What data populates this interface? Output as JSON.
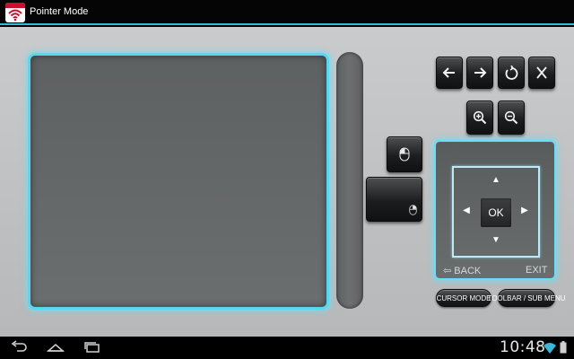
{
  "window": {
    "title": "Pointer Mode",
    "app_icon": "wifi-signal-icon",
    "accent_color": "#3ab7d6"
  },
  "toolbar": {
    "back_icon": "arrow-left-icon",
    "forward_icon": "arrow-right-icon",
    "reload_icon": "rotate-icon",
    "close_icon": "close-x-icon",
    "zoom_in_icon": "zoom-in-icon",
    "zoom_out_icon": "zoom-out-icon"
  },
  "mouse": {
    "left_click_icon": "mouse-left-button-icon",
    "right_click_icon": "mouse-right-button-icon"
  },
  "dpad": {
    "up": "▲",
    "down": "▼",
    "left": "◀",
    "right": "▶",
    "ok_label": "OK",
    "back_label": "⇦ BACK",
    "exit_label": "EXIT"
  },
  "buttons": {
    "cursor_mode": "CURSOR MODE",
    "toolbar_sub_menu": "TOOLBAR / SUB MENU"
  },
  "system_bar": {
    "clock": "10:48",
    "icons": [
      "back-icon",
      "home-icon",
      "recent-apps-icon",
      "wifi-icon",
      "battery-icon"
    ]
  }
}
